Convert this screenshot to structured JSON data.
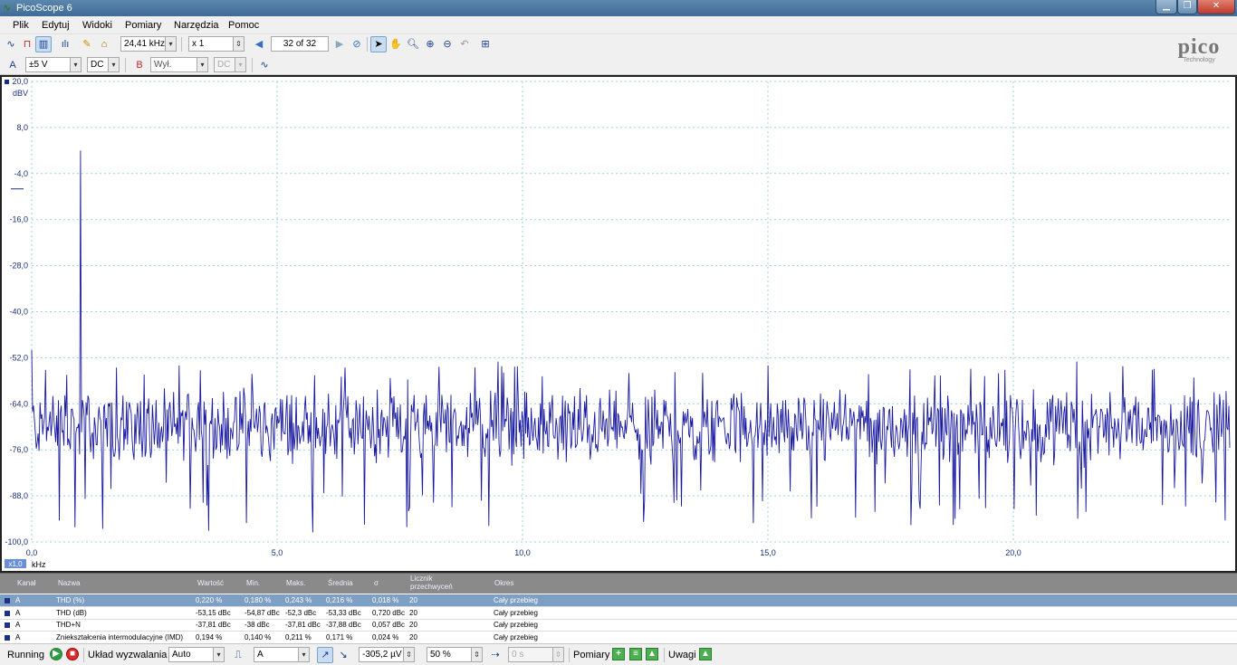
{
  "window": {
    "title": "PicoScope 6",
    "app_icon": "∿"
  },
  "menu": [
    "Plik",
    "Edytuj",
    "Widoki",
    "Pomiary",
    "Narzędzia",
    "Pomoc"
  ],
  "toolbar": {
    "frequency": "24,41 kHz",
    "zoom": "x 1",
    "buffer": "32 of 32"
  },
  "channels": {
    "a_label": "A",
    "a_range": "±5 V",
    "a_coupling": "DC",
    "b_label": "B",
    "b_range": "Wył.",
    "b_coupling": "DC"
  },
  "logo": {
    "name": "pico",
    "sub": "Technology"
  },
  "plot": {
    "y_unit": "dBV",
    "x_unit": "kHz",
    "x_scale_badge": "x1,0",
    "y_ticks": [
      "20,0",
      "8,0",
      "-4,0",
      "-16,0",
      "-28,0",
      "-40,0",
      "-52,0",
      "-64,0",
      "-76,0",
      "-88,0",
      "-100,0"
    ],
    "x_ticks": [
      "0,0",
      "5,0",
      "10,0",
      "15,0",
      "20,0"
    ],
    "trace_color": "#1a1aa0",
    "grid_color": "#9fcfdf"
  },
  "chart_data": {
    "type": "line",
    "xlabel": "kHz",
    "ylabel": "dBV",
    "xlim": [
      0,
      24.41
    ],
    "ylim": [
      -100,
      20
    ],
    "grid": true,
    "series": [
      {
        "peaks": [
          {
            "x": 0.0,
            "y": -50
          },
          {
            "x": 1.0,
            "y": 2
          },
          {
            "x": 3.0,
            "y": -54
          },
          {
            "x": 9.5,
            "y": -53
          },
          {
            "x": 15.0,
            "y": -54
          },
          {
            "x": 21.3,
            "y": -53
          }
        ],
        "noise_floor": {
          "center": -70,
          "spread": [
            -98,
            -54
          ]
        }
      }
    ]
  },
  "measurements": {
    "headers": [
      "Kanał",
      "Nazwa",
      "Wartość",
      "Min.",
      "Maks.",
      "Średnia",
      "σ",
      "Licznik przechwyceń",
      "Okres"
    ],
    "rows": [
      [
        "A",
        "THD (%)",
        "0,220 %",
        "0,180 %",
        "0,243 %",
        "0,216 %",
        "0,018 %",
        "20",
        "Cały przebieg"
      ],
      [
        "A",
        "THD (dB)",
        "-53,15 dBc",
        "-54,87 dBc",
        "-52,3 dBc",
        "-53,33 dBc",
        "0,720 dBc",
        "20",
        "Cały przebieg"
      ],
      [
        "A",
        "THD+N",
        "-37,81 dBc",
        "-38 dBc",
        "-37,81 dBc",
        "-37,88 dBc",
        "0,057 dBc",
        "20",
        "Cały przebieg"
      ],
      [
        "A",
        "Zniekształcenia intermodulacyjne (IMD)",
        "0,194 %",
        "0,140 %",
        "0,211 %",
        "0,171 %",
        "0,024 %",
        "20",
        "Cały przebieg"
      ]
    ]
  },
  "status": {
    "running": "Running",
    "trigger_label": "Układ wyzwalania",
    "trigger_mode": "Auto",
    "trigger_channel": "A",
    "threshold": "-305,2 µV",
    "pretrigger": "50 %",
    "delay": "0 s",
    "measurements_label": "Pomiary",
    "notes_label": "Uwagi"
  }
}
